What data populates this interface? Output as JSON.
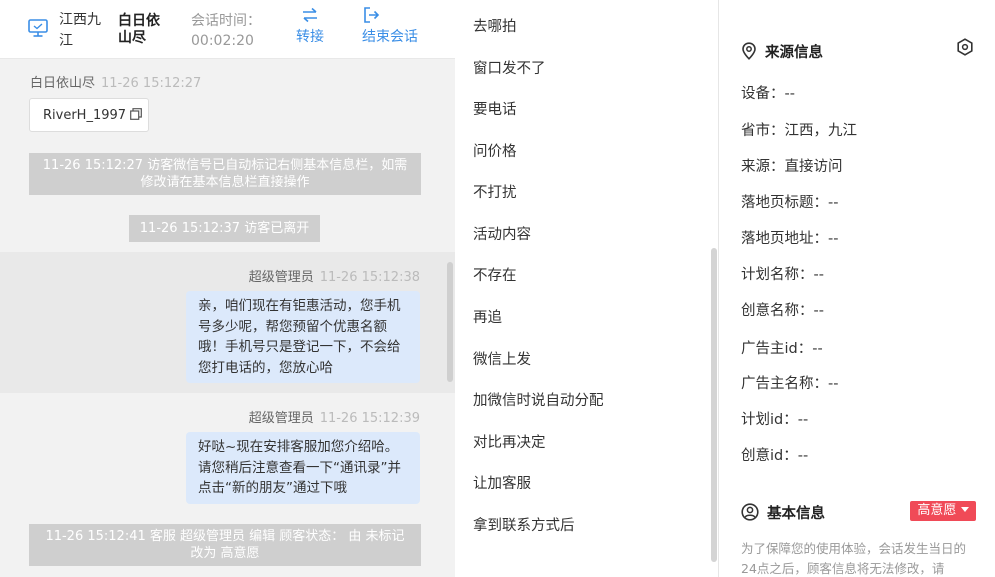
{
  "header": {
    "location": "江西九江",
    "visitor_name": "白日依山尽",
    "session_label": "会话时间：",
    "session_time": "00:02:20",
    "transfer_label": "转接",
    "end_label": "结束会话"
  },
  "chat": {
    "visitor_name": "白日依山尽",
    "visitor_time": "11-26 15:12:27",
    "visitor_id": "RiverH_1997",
    "system_1": "11-26 15:12:27 访客微信号已自动标记右侧基本信息栏，如需修改请在基本信息栏直接操作",
    "system_2": "11-26 15:12:37 访客已离开",
    "msg_1_sender": "超级管理员",
    "msg_1_time": "11-26 15:12:38",
    "msg_1_text": "亲，咱们现在有钜惠活动，您手机号多少呢，帮您预留个优惠名额哦！手机号只是登记一下，不会给您打电话的，您放心哈",
    "msg_2_sender": "超级管理员",
    "msg_2_time": "11-26 15:12:39",
    "msg_2_text": "好哒~现在安排客服加您介绍哈。请您稍后注意查看一下“通讯录”并点击“新的朋友”通过下哦",
    "system_3": "11-26 15:12:41 客服 超级管理员 编辑 顾客状态： 由 未标记 改为 高意愿"
  },
  "quick_replies": [
    "去哪拍",
    "窗口发不了",
    "要电话",
    "问价格",
    "不打扰",
    "活动内容",
    "不存在",
    "再追",
    "微信上发",
    "加微信时说自动分配",
    "对比再决定",
    "让加客服",
    "拿到联系方式后"
  ],
  "info": {
    "source_title": "来源信息",
    "rows": [
      "设备：--",
      "省市：江西，九江",
      "来源：直接访问",
      "落地页标题：--",
      "落地页地址：--",
      "计划名称：--",
      "创意名称：--",
      "广告主id：--",
      "广告主名称：--",
      "计划id：--",
      "创意id：--"
    ],
    "basic_title": "基本信息",
    "intent_badge": "高意愿",
    "notice": "为了保障您的使用体验，会话发生当日的24点之后，顾客信息将无法修改，请"
  },
  "colors": {
    "accent": "#3a8ee6",
    "bubble": "#dce9fb",
    "badge": "#f04a57",
    "system": "#cfcfcf"
  }
}
